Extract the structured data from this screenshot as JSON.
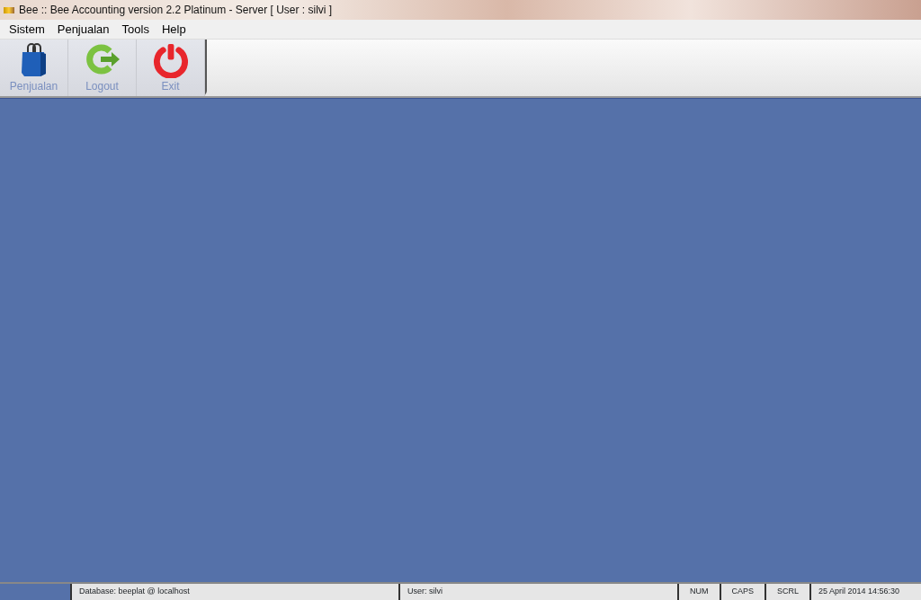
{
  "window": {
    "title": "Bee :: Bee Accounting version 2.2 Platinum - Server  [ User : silvi ]"
  },
  "menu": [
    {
      "label": "Sistem"
    },
    {
      "label": "Penjualan"
    },
    {
      "label": "Tools"
    },
    {
      "label": "Help"
    }
  ],
  "toolbar": [
    {
      "label": "Penjualan",
      "kind": "bag"
    },
    {
      "label": "Logout",
      "kind": "logout"
    },
    {
      "label": "Exit",
      "kind": "power"
    }
  ],
  "status_bar": {
    "database": "Database: beeplat @ localhost",
    "user": "User: silvi",
    "num": "NUM",
    "caps": "CAPS",
    "scrl": "SCRL",
    "datetime": "25 April 2014  14:56:30"
  }
}
